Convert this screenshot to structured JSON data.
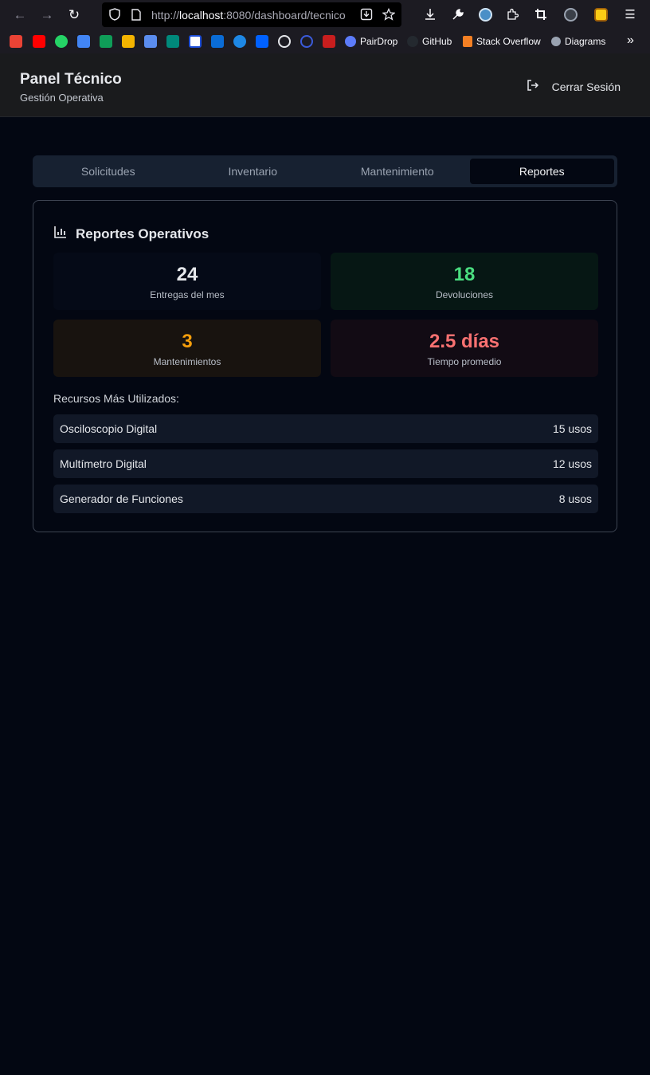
{
  "browser": {
    "url_prefix": "http://",
    "url_host": "localhost",
    "url_rest": ":8080/dashboard/tecnico",
    "bookmarks": [
      {
        "icon": "pairdrop-icon",
        "label": "PairDrop"
      },
      {
        "icon": "github-icon",
        "label": "GitHub"
      },
      {
        "icon": "stackoverflow-icon",
        "label": "Stack Overflow"
      },
      {
        "icon": "diagrams-icon",
        "label": "Diagrams"
      }
    ]
  },
  "header": {
    "title": "Panel Técnico",
    "subtitle": "Gestión Operativa",
    "logout_label": "Cerrar Sesión"
  },
  "tabs": [
    {
      "label": "Solicitudes",
      "active": false
    },
    {
      "label": "Inventario",
      "active": false
    },
    {
      "label": "Mantenimiento",
      "active": false
    },
    {
      "label": "Reportes",
      "active": true
    }
  ],
  "report": {
    "title": "Reportes Operativos",
    "stats": [
      {
        "value": "24",
        "label": "Entregas del mes",
        "color": "#e5e7eb",
        "bg": "#050a17"
      },
      {
        "value": "18",
        "label": "Devoluciones",
        "color": "#4ade80",
        "bg": "#061714"
      },
      {
        "value": "3",
        "label": "Mantenimientos",
        "color": "#f59e0b",
        "bg": "#18130f"
      },
      {
        "value": "2.5 días",
        "label": "Tiempo promedio",
        "color": "#f87171",
        "bg": "#120b14"
      }
    ],
    "resources_label": "Recursos Más Utilizados:",
    "resources": [
      {
        "name": "Osciloscopio Digital",
        "uses": "15 usos"
      },
      {
        "name": "Multímetro Digital",
        "uses": "12 usos"
      },
      {
        "name": "Generador de Funciones",
        "uses": "8 usos"
      }
    ]
  }
}
